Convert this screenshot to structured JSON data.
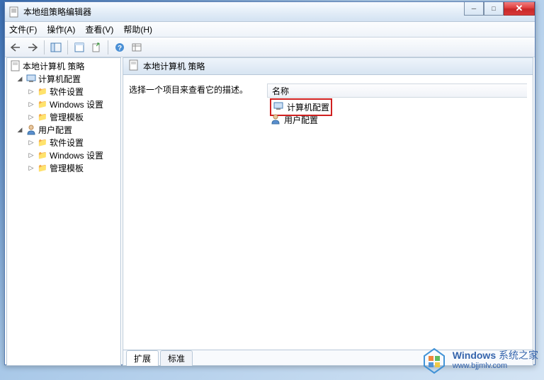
{
  "window": {
    "title": "本地组策略编辑器"
  },
  "menubar": {
    "file": "文件(F)",
    "action": "操作(A)",
    "view": "查看(V)",
    "help": "帮助(H)"
  },
  "tree": {
    "root": "本地计算机 策略",
    "computer_config": "计算机配置",
    "user_config": "用户配置",
    "software_settings": "软件设置",
    "windows_settings": "Windows 设置",
    "admin_templates": "管理模板"
  },
  "detail": {
    "header_title": "本地计算机 策略",
    "instruction": "选择一个项目来查看它的描述。",
    "column_name": "名称",
    "items": {
      "computer_config": "计算机配置",
      "user_config": "用户配置"
    }
  },
  "tabs": {
    "extended": "扩展",
    "standard": "标准"
  },
  "watermark": {
    "line1_a": "Windows",
    "line1_b": "系统之家",
    "line2": "www.bjjmlv.com"
  }
}
